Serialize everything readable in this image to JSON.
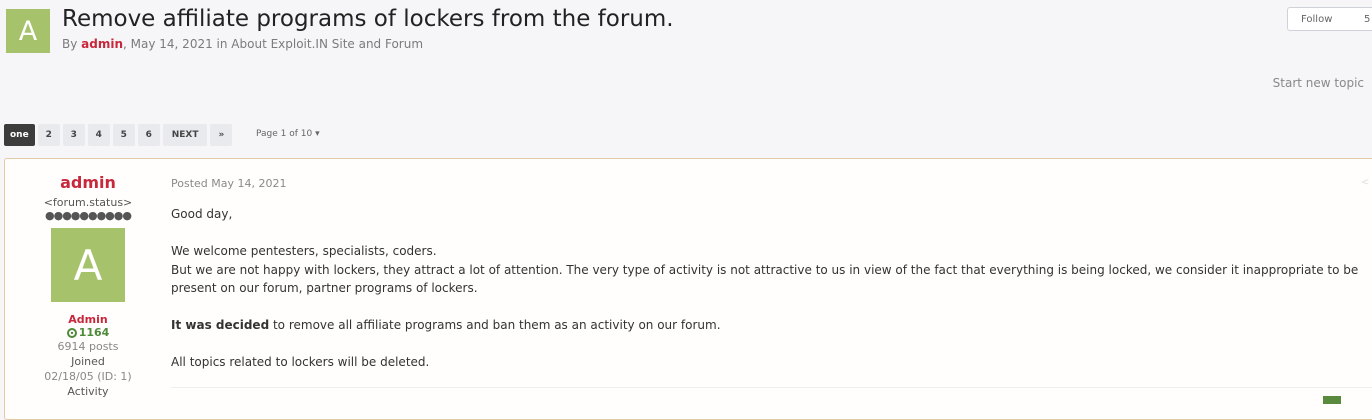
{
  "topic": {
    "avatar_letter": "A",
    "title": "Remove affiliate programs of lockers from the forum.",
    "meta_by": "By",
    "meta_author": "admin",
    "meta_rest": ", May 14, 2021 in About Exploit.IN Site and Forum"
  },
  "follow": {
    "label": "Follow",
    "count": "5"
  },
  "start_new_topic": "Start new topic",
  "pagination": {
    "pages": [
      "one",
      "2",
      "3",
      "4",
      "5",
      "6"
    ],
    "next": "NEXT",
    "last": "»",
    "page_info": "Page 1 of 10"
  },
  "post": {
    "author": {
      "name": "admin",
      "status": "<forum.status>",
      "rank_dots": "●●●●●●●●●●",
      "photo_letter": "A",
      "group": "Admin",
      "reputation": "1164",
      "posts": "6914 posts",
      "joined_label": "Joined",
      "joined_value": "02/18/05 (ID: 1)",
      "activity_label": "Activity"
    },
    "date": "Posted May 14, 2021",
    "paragraphs": {
      "p1": "Good day,",
      "p2": "We welcome pentesters, specialists, coders.",
      "p3": "But we are not happy with lockers, they attract a lot of attention. The very type of activity is not attractive to us in view of the fact that everything is being locked, we consider it inappropriate to be present on our forum, partner programs of lockers.",
      "p4_bold": "It was decided",
      "p4_rest": " to remove all affiliate programs and ban them as an activity on our forum.",
      "p5": "All topics related to lockers will be deleted."
    }
  },
  "colors": {
    "accent_red": "#c8283c",
    "avatar_green": "#a6c26a",
    "reputation_green": "#4f8a3b",
    "post_border": "#e4c9a6"
  }
}
